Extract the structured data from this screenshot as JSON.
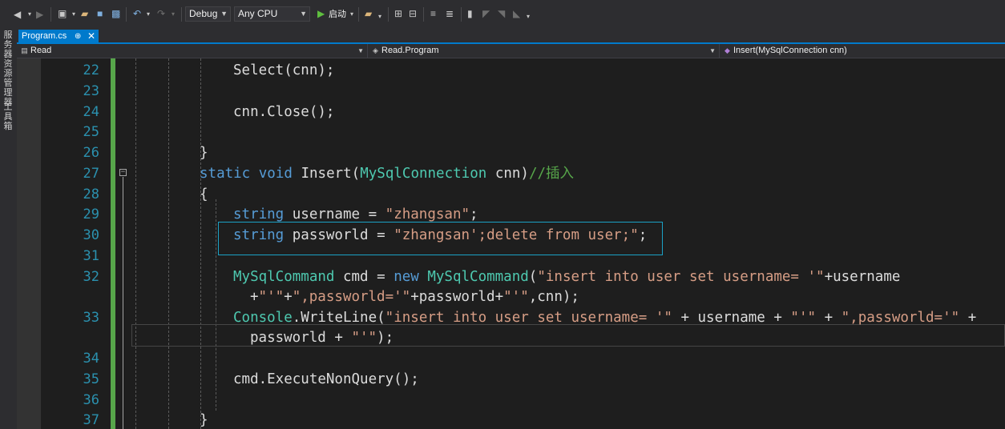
{
  "toolbar": {
    "back_icon": "back-arrow-icon",
    "forward_icon": "forward-arrow-icon",
    "configuration": "Debug",
    "platform": "Any CPU",
    "start_label": "启动",
    "start_color": "#5fbf3f"
  },
  "left_strip": {
    "items": [
      "服务器资源管理器",
      "工具箱"
    ]
  },
  "tab": {
    "filename": "Program.cs",
    "pin_glyph": "⊕",
    "close_glyph": "✕",
    "accent_color": "#007acc"
  },
  "navbar": {
    "project": "Read",
    "class": "Read.Program",
    "member": "Insert(MySqlConnection cnn)"
  },
  "editor": {
    "line_numbers": [
      "22",
      "23",
      "24",
      "25",
      "26",
      "27",
      "28",
      "29",
      "30",
      "31",
      "32",
      "",
      "33",
      "",
      "34",
      "35",
      "36",
      "37"
    ],
    "code": {
      "l22": "Select(cnn);",
      "l24": "cnn.Close();",
      "l26": "}",
      "l27_static": "static",
      "l27_void": "void",
      "l27_name": "Insert(",
      "l27_type": "MySqlConnection",
      "l27_rest": " cnn)",
      "l27_comment": "//插入",
      "l28": "{",
      "l29_type": "string",
      "l29_mid": " username = ",
      "l29_str": "\"zhangsan\"",
      "l29_end": ";",
      "l30_type": "string",
      "l30_mid": " passworld = ",
      "l30_str": "\"zhangsan';delete from user;\"",
      "l30_end": ";",
      "l32_type1": "MySqlCommand",
      "l32_mid1": " cmd = ",
      "l32_new": "new",
      "l32_sp": " ",
      "l32_type2": "MySqlCommand",
      "l32_paren": "(",
      "l32_str1": "\"insert into user set username= '\"",
      "l32_tail": "+username",
      "l32b_plus1": "+",
      "l32b_str1": "\"'\"",
      "l32b_plus2": "+",
      "l32b_str2": "\",passworld='\"",
      "l32b_mid": "+passworld+",
      "l32b_str3": "\"'\"",
      "l32b_end": ",cnn);",
      "l33_type": "Console",
      "l33_call": ".WriteLine(",
      "l33_str1": "\"insert into user set username= '\"",
      "l33_mid1": " + username + ",
      "l33_str2": "\"'\"",
      "l33_mid2": " + ",
      "l33_str3": "\",passworld='\"",
      "l33_mid3": " +",
      "l33b_mid": "passworld + ",
      "l33b_str": "\"'\"",
      "l33b_end": ");",
      "l35": "cmd.ExecuteNonQuery();",
      "l37": "}"
    },
    "colors": {
      "keyword": "#569cd6",
      "type": "#4ec9b0",
      "string": "#d69d85",
      "comment": "#57a64a",
      "line_number": "#2b91af"
    }
  }
}
